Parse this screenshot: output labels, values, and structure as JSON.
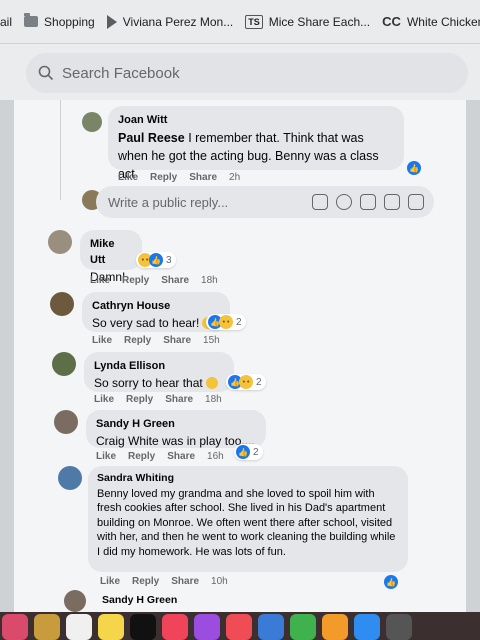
{
  "bookmarks": [
    {
      "label": "ail",
      "icon": "none"
    },
    {
      "label": "Shopping",
      "icon": "folder-icon"
    },
    {
      "label": "Viviana Perez Mon...",
      "icon": "play-icon"
    },
    {
      "label": "Mice Share Each...",
      "icon": "ts-icon",
      "icon_text": "TS"
    },
    {
      "label": "White Chicken Ch",
      "icon": "cc-icon",
      "icon_text": "CC"
    }
  ],
  "search": {
    "placeholder": "Search Facebook"
  },
  "comments": [
    {
      "author": "Joan Witt",
      "mention": "Paul Reese",
      "text": " I remember that. Think that was when he got the acting bug. Benny was a class act",
      "actions": [
        "Like",
        "Reply",
        "Share"
      ],
      "time": "2h",
      "reactions": {
        "types": [
          "like"
        ],
        "count": ""
      }
    },
    {
      "author": "Mike Utt",
      "text": "Damn!",
      "actions": [
        "Like",
        "Reply",
        "Share"
      ],
      "time": "18h",
      "reactions": {
        "types": [
          "sad",
          "like"
        ],
        "count": "3"
      }
    },
    {
      "author": "Cathryn House",
      "text": "So very sad to hear!",
      "actions": [
        "Like",
        "Reply",
        "Share"
      ],
      "time": "15h",
      "reactions": {
        "types": [
          "like",
          "sad"
        ],
        "count": "2"
      }
    },
    {
      "author": "Lynda Ellison",
      "text": "So sorry to hear that",
      "actions": [
        "Like",
        "Reply",
        "Share"
      ],
      "time": "18h",
      "reactions": {
        "types": [
          "like",
          "sad"
        ],
        "count": "2"
      }
    },
    {
      "author": "Sandy H Green",
      "text": "Craig White was in play too....",
      "actions": [
        "Like",
        "Reply",
        "Share"
      ],
      "time": "16h",
      "reactions": {
        "types": [
          "like"
        ],
        "count": "2"
      }
    },
    {
      "author": "Sandra Whiting",
      "text": "Benny loved my grandma and she loved to spoil him with fresh cookies after school. She lived in his Dad's apartment building on Monroe. We often went there after school, visited with her, and then he went to work cleaning the building while I did my homework. He was lots of fun.",
      "actions": [
        "Like",
        "Reply",
        "Share"
      ],
      "time": "10h",
      "reactions": {
        "types": [
          "like"
        ],
        "count": ""
      }
    },
    {
      "author": "Sandy H Green"
    }
  ],
  "reply_box": {
    "placeholder": "Write a public reply..."
  },
  "colors": {
    "like": "#1877f2",
    "sad": "#f5c33b",
    "bubble": "#e4e6e9"
  }
}
